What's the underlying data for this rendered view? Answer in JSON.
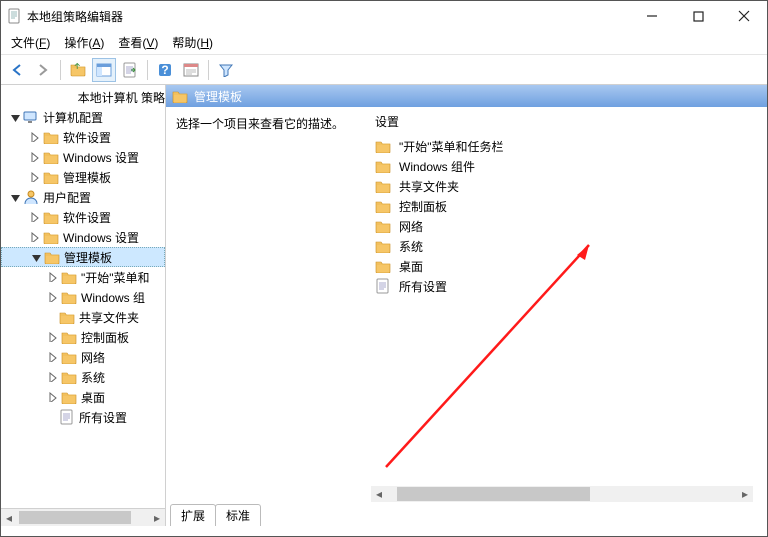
{
  "window": {
    "title": "本地组策略编辑器"
  },
  "menu": {
    "file": "文件(F)",
    "action": "操作(A)",
    "view": "查看(V)",
    "help": "帮助(H)"
  },
  "tree": {
    "root": "本地计算机 策略",
    "computer": "计算机配置",
    "user": "用户配置",
    "software": "软件设置",
    "windows": "Windows 设置",
    "admin": "管理模板",
    "startmenu": "\"开始\"菜单和",
    "wincomp": "Windows 组",
    "shared": "共享文件夹",
    "control": "控制面板",
    "network": "网络",
    "system": "系统",
    "desktop": "桌面",
    "allsettings": "所有设置"
  },
  "crumb": {
    "label": "管理模板"
  },
  "detail": {
    "hint": "选择一个项目来查看它的描述。",
    "col": "设置",
    "items": {
      "startmenu": "\"开始\"菜单和任务栏",
      "wincomp": "Windows 组件",
      "shared": "共享文件夹",
      "control": "控制面板",
      "network": "网络",
      "system": "系统",
      "desktop": "桌面",
      "allsettings": "所有设置"
    }
  },
  "tabs": {
    "ext": "扩展",
    "std": "标准"
  }
}
